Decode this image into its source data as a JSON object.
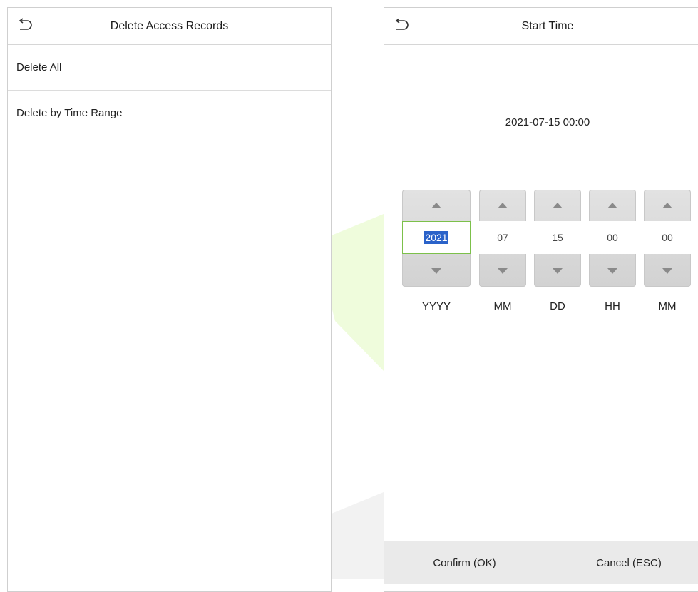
{
  "left_screen": {
    "title": "Delete Access Records",
    "back_icon": "back-arrow-icon",
    "menu": [
      {
        "label": "Delete All"
      },
      {
        "label": "Delete by Time Range"
      }
    ]
  },
  "right_screen": {
    "title": "Start Time",
    "back_icon": "back-arrow-icon",
    "current_datetime": "2021-07-15 00:00",
    "fields": [
      {
        "value": "2021",
        "unit": "YYYY",
        "selected": true
      },
      {
        "value": "07",
        "unit": "MM"
      },
      {
        "value": "15",
        "unit": "DD"
      },
      {
        "value": "00",
        "unit": "HH"
      },
      {
        "value": "00",
        "unit": "MM"
      }
    ],
    "buttons": {
      "confirm": "Confirm (OK)",
      "cancel": "Cancel (ESC)"
    }
  },
  "colors": {
    "selection": "#2a62c9",
    "focus_border": "#7cc04a",
    "watermark": "#e9fbd4"
  }
}
